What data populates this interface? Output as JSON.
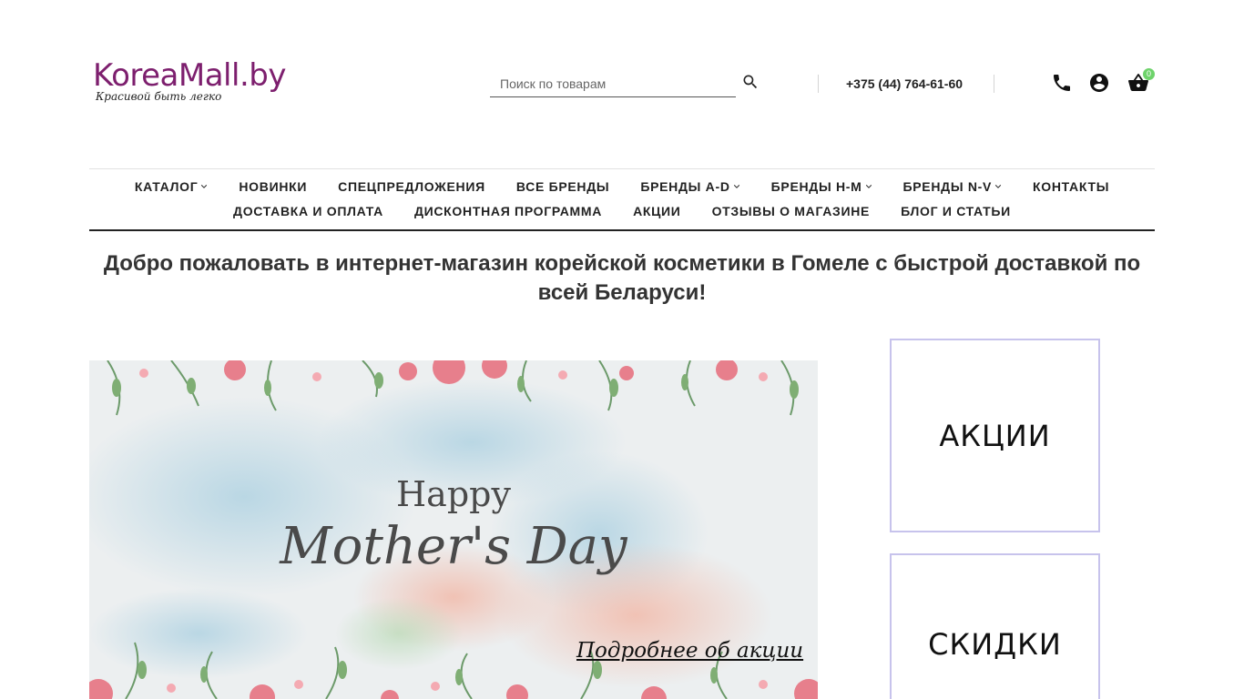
{
  "header": {
    "logo_text": "KoreaMall.by",
    "logo_tagline": "Красивой быть легко",
    "search_placeholder": "Поиск по товарам",
    "phone": "+375 (44) 764-61-60",
    "cart_count": "0",
    "icons": [
      "search-icon",
      "phone-icon",
      "account-icon",
      "cart-icon"
    ]
  },
  "nav": {
    "row1": [
      {
        "label": "КАТАЛОГ"
      },
      {
        "label": "НОВИНКИ"
      },
      {
        "label": "СПЕЦПРЕДЛОЖЕНИЯ"
      },
      {
        "label": "ВСЕ БРЕНДЫ"
      },
      {
        "label": "БРЕНДЫ A-D"
      },
      {
        "label": "БРЕНДЫ H-M"
      },
      {
        "label": "БРЕНДЫ N-V"
      },
      {
        "label": "КОНТАКТЫ"
      }
    ],
    "row2": [
      {
        "label": "ДОСТАВКА И ОПЛАТА"
      },
      {
        "label": "ДИСКОНТНАЯ ПРОГРАММА"
      },
      {
        "label": "АКЦИИ"
      },
      {
        "label": "ОТЗЫВЫ О МАГАЗИНЕ"
      },
      {
        "label": "БЛОГ И СТАТЬИ"
      }
    ]
  },
  "main": {
    "welcome": "Добро пожаловать в интернет-магазин корейской косметики в Гомеле с быстрой доставкой по всей Беларуси!",
    "banner": {
      "line1": "Happy",
      "line2": "Mother's Day",
      "link": "Подробнее об акции"
    },
    "side_cards": [
      {
        "label": "АКЦИИ"
      },
      {
        "label": "СКИДКИ"
      }
    ]
  },
  "colors": {
    "brand": "#7d1f6e",
    "cart_badge": "#6ed36b",
    "card_border": "#c7c3ec",
    "text": "#222222"
  }
}
